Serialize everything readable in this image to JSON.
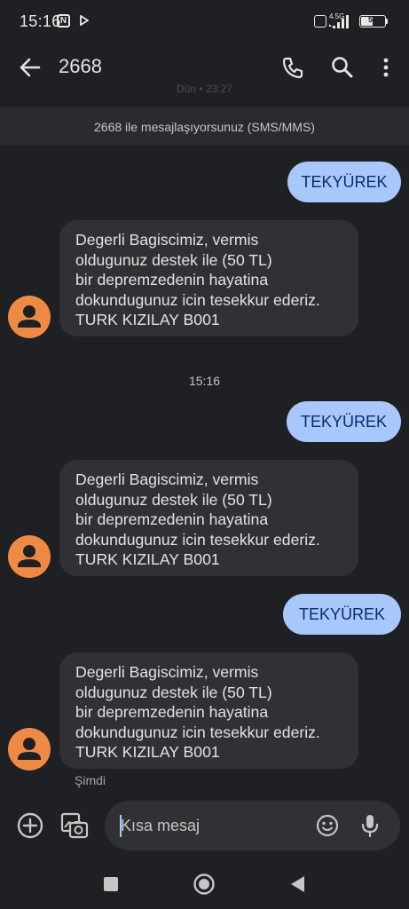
{
  "status_bar": {
    "time": "15:16",
    "network": "4.5G",
    "battery": "55",
    "battery_level_percent": 55
  },
  "app_bar": {
    "title": "2668",
    "faded_date": "Dün • 23:27"
  },
  "info_banner": "2668 ile mesajlaşıyorsunuz (SMS/MMS)",
  "messages": [
    {
      "direction": "outgoing",
      "text": "TEKYÜREK"
    },
    {
      "direction": "incoming",
      "lines": [
        "Degerli Bagiscimiz, vermis",
        "oldugunuz destek ile (50 TL)",
        "bir depremzedenin hayatina",
        "dokundugunuz icin tesekkur ederiz.",
        "TURK KIZILAY B001"
      ]
    },
    {
      "direction": "timestamp",
      "text": "15:16"
    },
    {
      "direction": "outgoing",
      "text": "TEKYÜREK"
    },
    {
      "direction": "incoming",
      "lines": [
        "Degerli Bagiscimiz, vermis",
        "oldugunuz destek ile (50 TL)",
        "bir depremzedenin hayatina",
        "dokundugunuz icin tesekkur ederiz.",
        "TURK KIZILAY B001"
      ]
    },
    {
      "direction": "outgoing",
      "text": "TEKYÜREK"
    },
    {
      "direction": "incoming",
      "lines": [
        "Degerli Bagiscimiz, vermis",
        "oldugunuz destek ile (50 TL)",
        "bir depremzedenin hayatina",
        "dokundugunuz icin tesekkur ederiz.",
        "TURK KIZILAY B001"
      ]
    }
  ],
  "last_status": "Şimdi",
  "composer": {
    "placeholder": "Kısa mesaj"
  },
  "colors": {
    "background": "#1f2023",
    "outgoing_bubble": "#a8c7fa",
    "incoming_bubble": "#303134",
    "avatar": "#ef8a45"
  }
}
